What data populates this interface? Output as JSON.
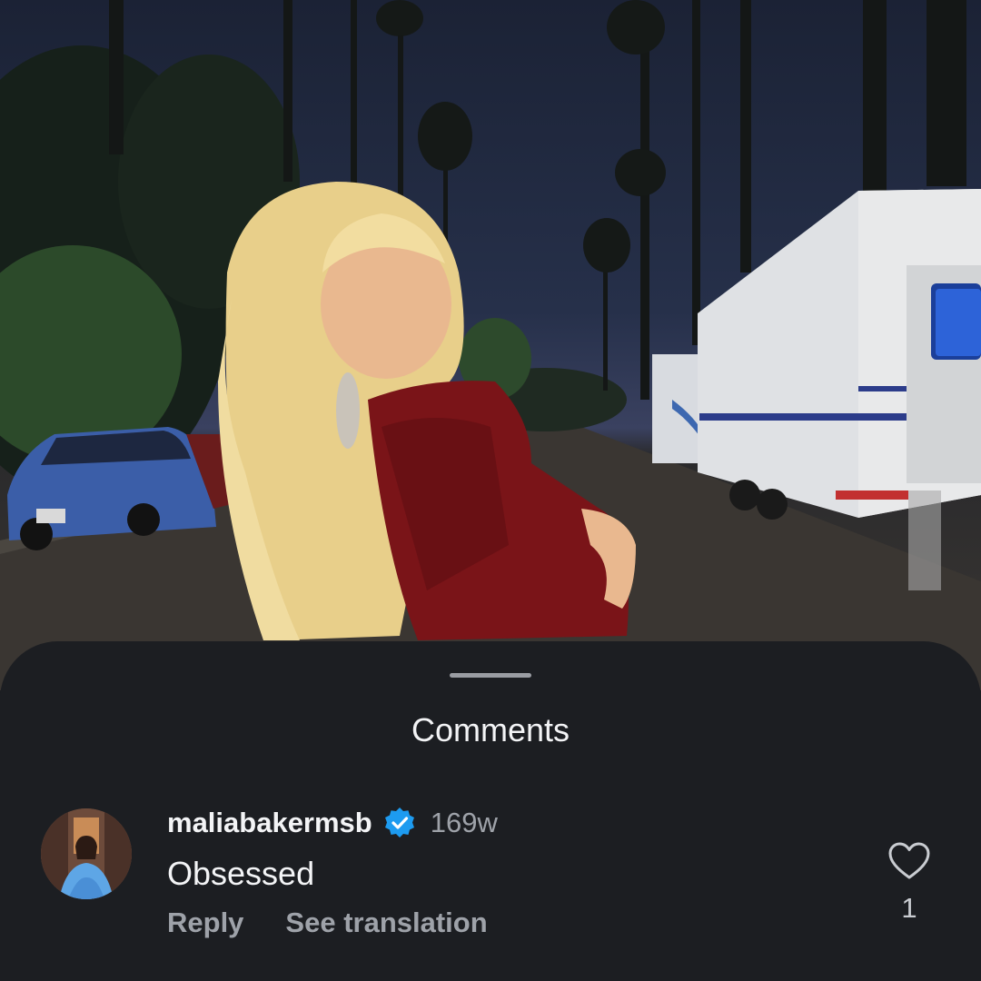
{
  "sheet": {
    "title": "Comments"
  },
  "comment": {
    "username": "maliabakermsb",
    "verified": true,
    "time": "169w",
    "text": "Obsessed",
    "reply_label": "Reply",
    "translate_label": "See translation",
    "like_count": "1",
    "liked": false
  },
  "colors": {
    "sheet_background": "#1c1e22",
    "verified_badge": "#1d9bf0",
    "secondary_text": "#9ea2a9",
    "primary_text": "#f3f4f6"
  },
  "icons": {
    "verified": "verified-badge-icon",
    "like": "heart-outline-icon"
  }
}
